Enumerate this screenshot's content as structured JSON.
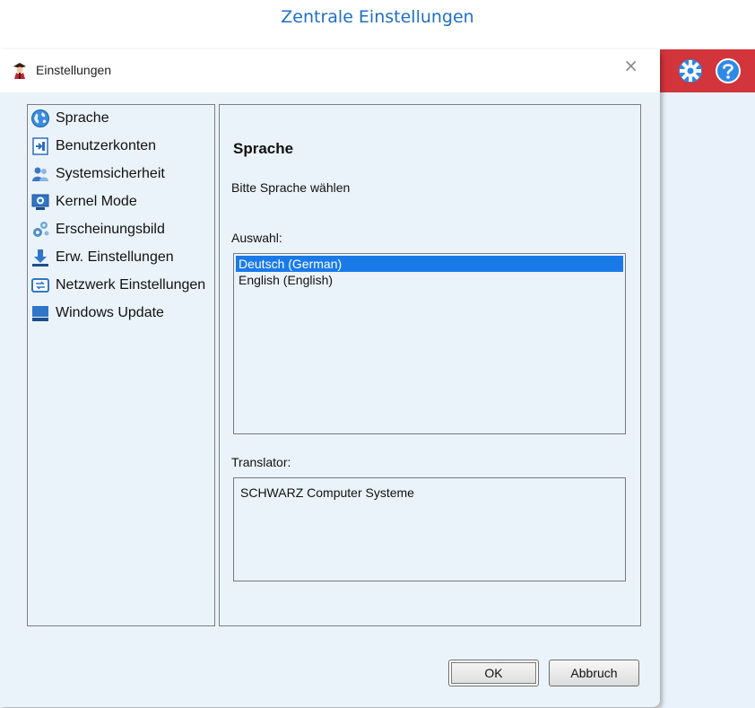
{
  "page_heading": "Zentrale Einstellungen",
  "toolbar": {
    "settings_icon": "gear-icon",
    "help_icon": "help-icon",
    "background": "#d2353b"
  },
  "dialog": {
    "title": "Einstellungen",
    "close_glyph": "×"
  },
  "nav": {
    "items": [
      {
        "label": "Sprache",
        "icon": "globe-icon"
      },
      {
        "label": "Benutzerkonten",
        "icon": "user-account-icon"
      },
      {
        "label": "Systemsicherheit",
        "icon": "users-security-icon"
      },
      {
        "label": "Kernel Mode",
        "icon": "kernel-icon"
      },
      {
        "label": "Erscheinungsbild",
        "icon": "gears-icon"
      },
      {
        "label": "Erw. Einstellungen",
        "icon": "download-icon"
      },
      {
        "label": "Netzwerk Einstellungen",
        "icon": "network-icon"
      },
      {
        "label": "Windows Update",
        "icon": "windows-update-icon"
      }
    ]
  },
  "content": {
    "title": "Sprache",
    "description": "Bitte Sprache wählen",
    "selection_label": "Auswahl:",
    "options": [
      {
        "label": "Deutsch (German)",
        "selected": true
      },
      {
        "label": "English (English)",
        "selected": false
      }
    ],
    "translator_label": "Translator:",
    "translator_value": "SCHWARZ Computer Systeme"
  },
  "buttons": {
    "ok": "OK",
    "cancel": "Abbruch"
  }
}
